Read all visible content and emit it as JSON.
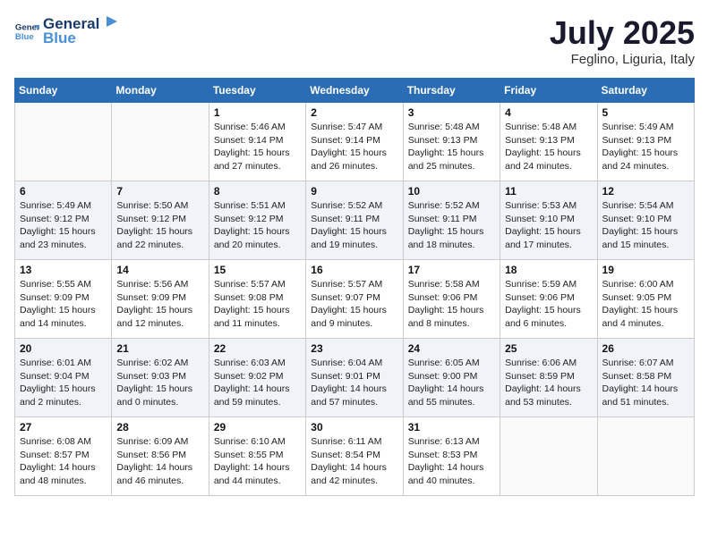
{
  "header": {
    "logo_line1": "General",
    "logo_line2": "Blue",
    "month_title": "July 2025",
    "subtitle": "Feglino, Liguria, Italy"
  },
  "weekdays": [
    "Sunday",
    "Monday",
    "Tuesday",
    "Wednesday",
    "Thursday",
    "Friday",
    "Saturday"
  ],
  "weeks": [
    [
      {
        "day": "",
        "info": ""
      },
      {
        "day": "",
        "info": ""
      },
      {
        "day": "1",
        "info": "Sunrise: 5:46 AM\nSunset: 9:14 PM\nDaylight: 15 hours and 27 minutes."
      },
      {
        "day": "2",
        "info": "Sunrise: 5:47 AM\nSunset: 9:14 PM\nDaylight: 15 hours and 26 minutes."
      },
      {
        "day": "3",
        "info": "Sunrise: 5:48 AM\nSunset: 9:13 PM\nDaylight: 15 hours and 25 minutes."
      },
      {
        "day": "4",
        "info": "Sunrise: 5:48 AM\nSunset: 9:13 PM\nDaylight: 15 hours and 24 minutes."
      },
      {
        "day": "5",
        "info": "Sunrise: 5:49 AM\nSunset: 9:13 PM\nDaylight: 15 hours and 24 minutes."
      }
    ],
    [
      {
        "day": "6",
        "info": "Sunrise: 5:49 AM\nSunset: 9:12 PM\nDaylight: 15 hours and 23 minutes."
      },
      {
        "day": "7",
        "info": "Sunrise: 5:50 AM\nSunset: 9:12 PM\nDaylight: 15 hours and 22 minutes."
      },
      {
        "day": "8",
        "info": "Sunrise: 5:51 AM\nSunset: 9:12 PM\nDaylight: 15 hours and 20 minutes."
      },
      {
        "day": "9",
        "info": "Sunrise: 5:52 AM\nSunset: 9:11 PM\nDaylight: 15 hours and 19 minutes."
      },
      {
        "day": "10",
        "info": "Sunrise: 5:52 AM\nSunset: 9:11 PM\nDaylight: 15 hours and 18 minutes."
      },
      {
        "day": "11",
        "info": "Sunrise: 5:53 AM\nSunset: 9:10 PM\nDaylight: 15 hours and 17 minutes."
      },
      {
        "day": "12",
        "info": "Sunrise: 5:54 AM\nSunset: 9:10 PM\nDaylight: 15 hours and 15 minutes."
      }
    ],
    [
      {
        "day": "13",
        "info": "Sunrise: 5:55 AM\nSunset: 9:09 PM\nDaylight: 15 hours and 14 minutes."
      },
      {
        "day": "14",
        "info": "Sunrise: 5:56 AM\nSunset: 9:09 PM\nDaylight: 15 hours and 12 minutes."
      },
      {
        "day": "15",
        "info": "Sunrise: 5:57 AM\nSunset: 9:08 PM\nDaylight: 15 hours and 11 minutes."
      },
      {
        "day": "16",
        "info": "Sunrise: 5:57 AM\nSunset: 9:07 PM\nDaylight: 15 hours and 9 minutes."
      },
      {
        "day": "17",
        "info": "Sunrise: 5:58 AM\nSunset: 9:06 PM\nDaylight: 15 hours and 8 minutes."
      },
      {
        "day": "18",
        "info": "Sunrise: 5:59 AM\nSunset: 9:06 PM\nDaylight: 15 hours and 6 minutes."
      },
      {
        "day": "19",
        "info": "Sunrise: 6:00 AM\nSunset: 9:05 PM\nDaylight: 15 hours and 4 minutes."
      }
    ],
    [
      {
        "day": "20",
        "info": "Sunrise: 6:01 AM\nSunset: 9:04 PM\nDaylight: 15 hours and 2 minutes."
      },
      {
        "day": "21",
        "info": "Sunrise: 6:02 AM\nSunset: 9:03 PM\nDaylight: 15 hours and 0 minutes."
      },
      {
        "day": "22",
        "info": "Sunrise: 6:03 AM\nSunset: 9:02 PM\nDaylight: 14 hours and 59 minutes."
      },
      {
        "day": "23",
        "info": "Sunrise: 6:04 AM\nSunset: 9:01 PM\nDaylight: 14 hours and 57 minutes."
      },
      {
        "day": "24",
        "info": "Sunrise: 6:05 AM\nSunset: 9:00 PM\nDaylight: 14 hours and 55 minutes."
      },
      {
        "day": "25",
        "info": "Sunrise: 6:06 AM\nSunset: 8:59 PM\nDaylight: 14 hours and 53 minutes."
      },
      {
        "day": "26",
        "info": "Sunrise: 6:07 AM\nSunset: 8:58 PM\nDaylight: 14 hours and 51 minutes."
      }
    ],
    [
      {
        "day": "27",
        "info": "Sunrise: 6:08 AM\nSunset: 8:57 PM\nDaylight: 14 hours and 48 minutes."
      },
      {
        "day": "28",
        "info": "Sunrise: 6:09 AM\nSunset: 8:56 PM\nDaylight: 14 hours and 46 minutes."
      },
      {
        "day": "29",
        "info": "Sunrise: 6:10 AM\nSunset: 8:55 PM\nDaylight: 14 hours and 44 minutes."
      },
      {
        "day": "30",
        "info": "Sunrise: 6:11 AM\nSunset: 8:54 PM\nDaylight: 14 hours and 42 minutes."
      },
      {
        "day": "31",
        "info": "Sunrise: 6:13 AM\nSunset: 8:53 PM\nDaylight: 14 hours and 40 minutes."
      },
      {
        "day": "",
        "info": ""
      },
      {
        "day": "",
        "info": ""
      }
    ]
  ]
}
